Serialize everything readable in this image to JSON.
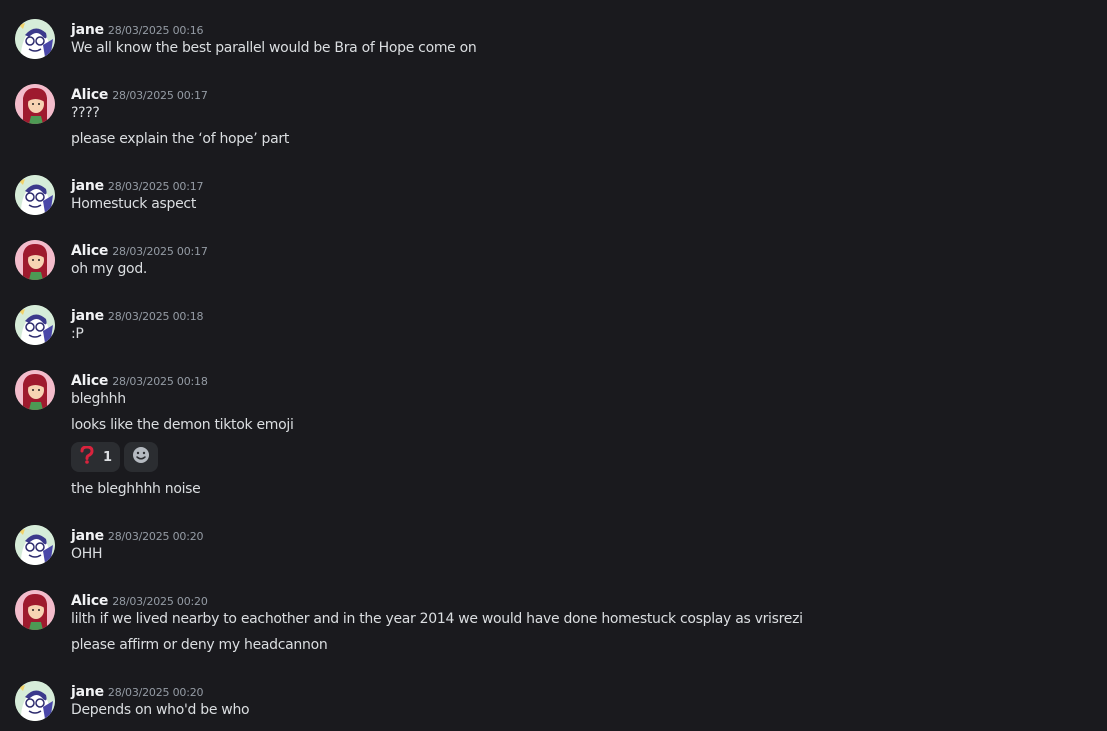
{
  "colors": {
    "background": "#1a1a1e",
    "author": "#f2f3f5",
    "timestamp": "#949ba4",
    "text": "#dbdee1",
    "reaction_bg": "#2b2d31"
  },
  "messages": [
    {
      "author": "jane",
      "timestamp": "28/03/2025 00:16",
      "avatar": "jane-avatar",
      "lines": [
        "We all know the best parallel would be Bra of Hope come on"
      ]
    },
    {
      "author": "Alice",
      "timestamp": "28/03/2025 00:17",
      "avatar": "alice-avatar",
      "lines": [
        "????",
        "please explain the ‘of hope’ part"
      ]
    },
    {
      "author": "jane",
      "timestamp": "28/03/2025 00:17",
      "avatar": "jane-avatar",
      "lines": [
        "Homestuck aspect"
      ]
    },
    {
      "author": "Alice",
      "timestamp": "28/03/2025 00:17",
      "avatar": "alice-avatar",
      "lines": [
        "oh my god."
      ]
    },
    {
      "author": "jane",
      "timestamp": "28/03/2025 00:18",
      "avatar": "jane-avatar",
      "lines": [
        ":P"
      ]
    },
    {
      "author": "Alice",
      "timestamp": "28/03/2025 00:18",
      "avatar": "alice-avatar",
      "lines": [
        "bleghhh",
        "looks like the demon tiktok emoji",
        "the bleghhhh noise"
      ],
      "reactions": [
        {
          "emoji": "question-mark-icon",
          "count": "1"
        },
        {
          "emoji": "add-reaction-icon"
        }
      ]
    },
    {
      "author": "jane",
      "timestamp": "28/03/2025 00:20",
      "avatar": "jane-avatar",
      "lines": [
        "OHH"
      ]
    },
    {
      "author": "Alice",
      "timestamp": "28/03/2025 00:20",
      "avatar": "alice-avatar",
      "lines": [
        "lilth if we lived nearby to eachother and in the year 2014 we would have done homestuck cosplay as vrisrezi",
        "please affirm or deny my headcannon"
      ]
    },
    {
      "author": "jane",
      "timestamp": "28/03/2025 00:20",
      "avatar": "jane-avatar",
      "lines": [
        "Depends on who'd be who"
      ]
    }
  ]
}
